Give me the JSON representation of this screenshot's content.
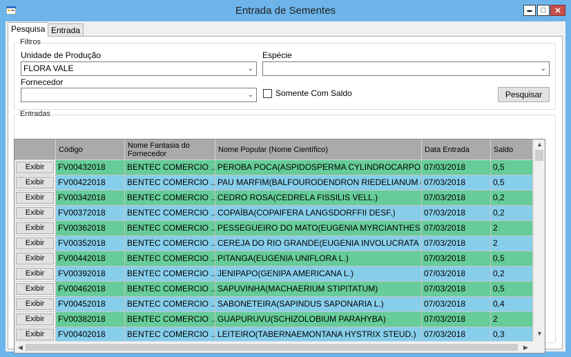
{
  "window": {
    "title": "Entrada de Sementes",
    "buttons": {
      "minimize": "▬",
      "maximize": "□",
      "close": "✕"
    }
  },
  "tabs": [
    {
      "label": "Pesquisa",
      "active": true
    },
    {
      "label": "Entrada",
      "active": false
    }
  ],
  "filtros": {
    "title": "Filtros",
    "unidade_label": "Unidade de Produção",
    "unidade_value": "FLORA VALE",
    "especie_label": "Espécie",
    "especie_value": "",
    "fornecedor_label": "Fornecedor",
    "fornecedor_value": "",
    "saldo_label": "Somente Com Saldo",
    "saldo_checked": false,
    "search_label": "Pesquisar"
  },
  "entradas": {
    "title": "Entradas",
    "columns": {
      "codigo": "Código",
      "fornecedor": "Nome Fantasia do Fornecedor",
      "popular": "Nome Popular (Nome Científico)",
      "data": "Data Entrada",
      "saldo": "Saldo"
    },
    "button_label": "Exibir",
    "colors": {
      "green": "#66cc99",
      "blue": "#87ceeb"
    },
    "rows": [
      {
        "codigo": "FV00432018",
        "fornecedor": "BENTEC COMERCIO ...",
        "popular": "PEROBA POCA(ASPIDOSPERMA CYLINDROCARPON  M...",
        "data": "07/03/2018",
        "saldo": "0,5",
        "color": "green"
      },
      {
        "codigo": "FV00422018",
        "fornecedor": "BENTEC COMERCIO ...",
        "popular": "PAU MARFIM(BALFOURODENDRON RIEDELIANUM  (E...",
        "data": "07/03/2018",
        "saldo": "0,5",
        "color": "blue"
      },
      {
        "codigo": "FV00342018",
        "fornecedor": "BENTEC COMERCIO ...",
        "popular": "CEDRO ROSA(CEDRELA FISSILIS  VELL.)",
        "data": "07/03/2018",
        "saldo": "0,2",
        "color": "green"
      },
      {
        "codigo": "FV00372018",
        "fornecedor": "BENTEC COMERCIO ...",
        "popular": "COPAÍBA(COPAIFERA LANGSDORFFII  DESF.)",
        "data": "07/03/2018",
        "saldo": "0,2",
        "color": "blue"
      },
      {
        "codigo": "FV00362018",
        "fornecedor": "BENTEC COMERCIO ...",
        "popular": "PESSEGUEIRO DO MATO(EUGENIA MYRCIANTHES  (...",
        "data": "07/03/2018",
        "saldo": "2",
        "color": "green"
      },
      {
        "codigo": "FV00352018",
        "fornecedor": "BENTEC COMERCIO ...",
        "popular": "CEREJA DO RIO GRANDE(EUGENIA INVOLUCRATA  DC.)",
        "data": "07/03/2018",
        "saldo": "2",
        "color": "blue"
      },
      {
        "codigo": "FV00442018",
        "fornecedor": "BENTEC COMERCIO ...",
        "popular": "PITANGA(EUGENIA UNIFLORA  L.)",
        "data": "07/03/2018",
        "saldo": "0,5",
        "color": "green"
      },
      {
        "codigo": "FV00392018",
        "fornecedor": "BENTEC COMERCIO ...",
        "popular": "JENIPAPO(GENIPA AMERICANA  L.)",
        "data": "07/03/2018",
        "saldo": "0,2",
        "color": "blue"
      },
      {
        "codigo": "FV00462018",
        "fornecedor": "BENTEC COMERCIO ...",
        "popular": "SAPUVINHA(MACHAERIUM STIPITATUM)",
        "data": "07/03/2018",
        "saldo": "0,5",
        "color": "green"
      },
      {
        "codigo": "FV00452018",
        "fornecedor": "BENTEC COMERCIO ...",
        "popular": "SABONETEIRA(SAPINDUS SAPONARIA  L.)",
        "data": "07/03/2018",
        "saldo": "0,4",
        "color": "blue"
      },
      {
        "codigo": "FV00382018",
        "fornecedor": "BENTEC COMERCIO ...",
        "popular": "GUAPURUVU(SCHIZOLOBIUM PARAHYBA)",
        "data": "07/03/2018",
        "saldo": "2",
        "color": "green"
      },
      {
        "codigo": "FV00402018",
        "fornecedor": "BENTEC COMERCIO ...",
        "popular": "LEITEIRO(TABERNAEMONTANA HYSTRIX  STEUD.)",
        "data": "07/03/2018",
        "saldo": "0,3",
        "color": "blue"
      }
    ]
  }
}
